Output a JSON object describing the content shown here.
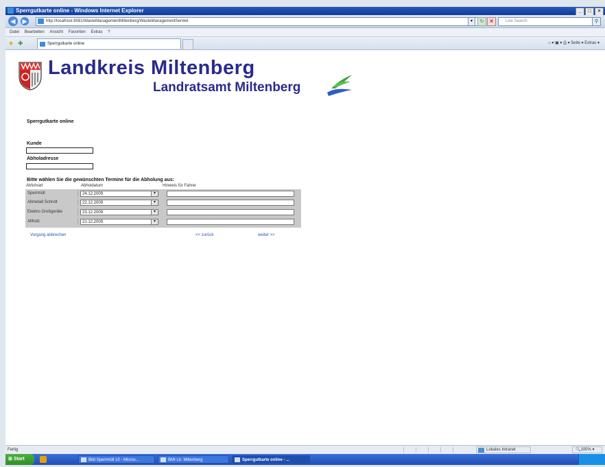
{
  "window": {
    "title": "Sperrgutkarte online - Windows Internet Explorer",
    "controls": [
      "_",
      "□",
      "×"
    ]
  },
  "browser": {
    "address": "http://localhost:8081/WasteManagementMiltenberg/WasteManagementServlet",
    "search_placeholder": "Live Search",
    "menu": [
      "Datei",
      "Bearbeiten",
      "Ansicht",
      "Favoriten",
      "Extras",
      "?"
    ],
    "tab_title": "Sperrgutkarte online",
    "command_bar": "Seite ▾   Extras ▾",
    "status_text": "Fertig",
    "zone": "Lokales Intranet",
    "zoom": "100%"
  },
  "page": {
    "header_title": "Landkreis Miltenberg",
    "header_subtitle": "Landratsamt Miltenberg",
    "app_title": "Sperrgutkarte online",
    "kunde_label": "Kunde",
    "abholadresse_label": "Abholadresse",
    "instruction": "Bitte wählen Sie die gewünschten Termine für die Abholung aus:",
    "columns": [
      "Abfuhrart",
      "Abholdatum",
      "Hinweis für Fahrer"
    ],
    "rows": [
      {
        "type": "Sperrmüll",
        "date": "24.12.2009"
      },
      {
        "type": "Altmetall Schrott",
        "date": "22.12.2009"
      },
      {
        "type": "Elektro Großgeräte",
        "date": "23.12.2009"
      },
      {
        "type": "Altholz",
        "date": "21.12.2009"
      }
    ],
    "link_cancel": "Vorgang abbrechen",
    "link_back": "<< zurück",
    "link_next": "weiter >>"
  },
  "taskbar": {
    "start": "Start",
    "tasks": [
      {
        "label": "Bild Sperrmüll 10 - Micros..."
      },
      {
        "label": "BMI Ltr. Miltenberg"
      },
      {
        "label": "Sperrgutkarte online - ..."
      }
    ]
  },
  "colors": {
    "brand_blue": "#2a2a8c",
    "link_blue": "#2d4fb6",
    "swoosh_green": "#3aa63a",
    "swoosh_blue": "#2f5bc9"
  }
}
